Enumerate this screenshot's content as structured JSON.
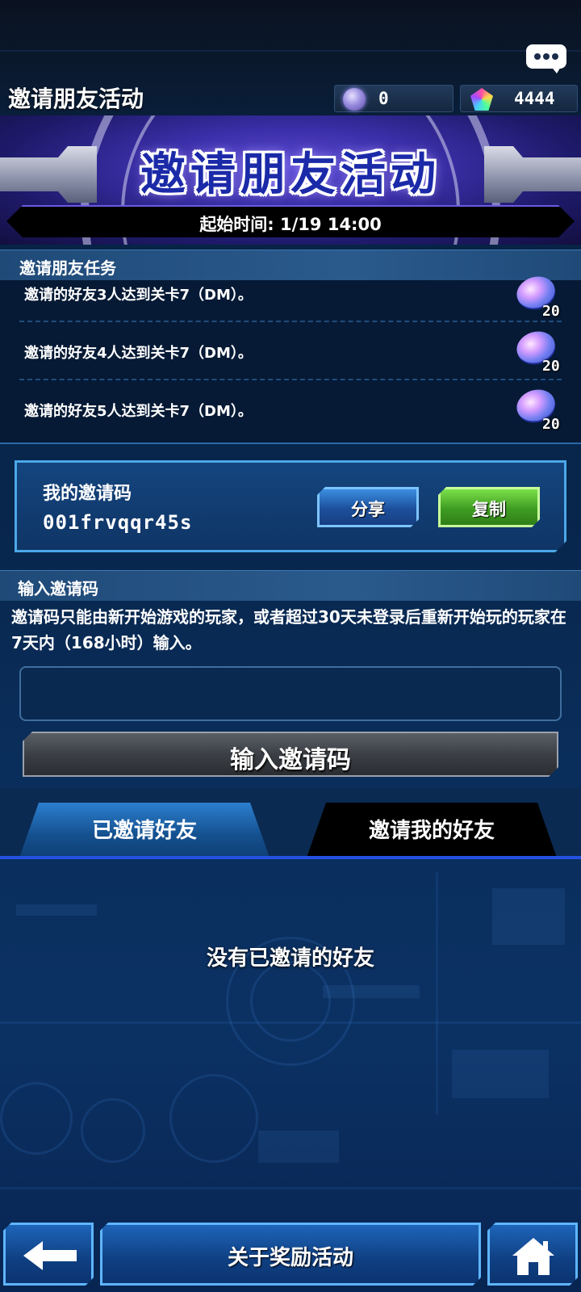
{
  "header": {
    "title": "邀请朋友活动",
    "orb_count": "0",
    "gem_count": "4444"
  },
  "banner": {
    "title": "邀请朋友活动",
    "start_time": "起始时间: 1/19 14:00"
  },
  "missions": {
    "header": "邀请朋友任务",
    "items": [
      {
        "text": "邀请的好友3人达到关卡7（DM）。",
        "reward": "20"
      },
      {
        "text": "邀请的好友4人达到关卡7（DM）。",
        "reward": "20"
      },
      {
        "text": "邀请的好友5人达到关卡7（DM）。",
        "reward": "20"
      }
    ]
  },
  "my_code": {
    "label": "我的邀请码",
    "value": "001frvqqr45s",
    "share_label": "分享",
    "copy_label": "复制"
  },
  "enter_code": {
    "header": "输入邀请码",
    "description": "邀请码只能由新开始游戏的玩家，或者超过30天未登录后重新开始玩的玩家在7天内（168小时）输入。",
    "input_value": "",
    "button_label": "输入邀请码"
  },
  "tabs": [
    {
      "label": "已邀请好友",
      "active": true
    },
    {
      "label": "邀请我的好友",
      "active": false
    }
  ],
  "empty_message": "没有已邀请的好友",
  "footer": {
    "about_label": "关于奖励活动",
    "back_icon": "back-arrow-icon",
    "home_icon": "home-icon"
  }
}
